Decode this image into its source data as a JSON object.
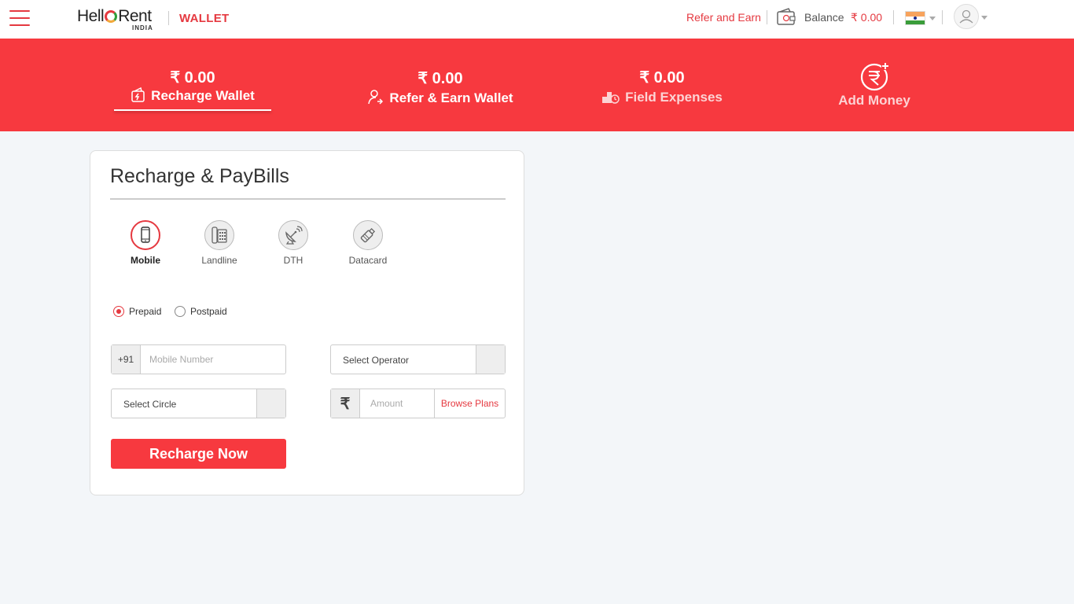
{
  "header": {
    "logo_text": "Hell",
    "logo_text2": "Rent",
    "logo_sub": "INDIA",
    "section": "WALLET",
    "refer_link": "Refer and Earn",
    "balance_label": "Balance",
    "balance_value": "₹ 0.00"
  },
  "banner": {
    "tabs": [
      {
        "amount": "₹ 0.00",
        "label": "Recharge Wallet"
      },
      {
        "amount": "₹ 0.00",
        "label": "Refer & Earn Wallet"
      },
      {
        "amount": "₹ 0.00",
        "label": "Field Expenses"
      },
      {
        "label": "Add Money"
      }
    ]
  },
  "recharge": {
    "title": "Recharge & PayBills",
    "services": [
      {
        "label": "Mobile",
        "icon": "mobile-icon"
      },
      {
        "label": "Landline",
        "icon": "landline-icon"
      },
      {
        "label": "DTH",
        "icon": "dish-antenna-icon"
      },
      {
        "label": "Datacard",
        "icon": "datacard-icon"
      }
    ],
    "plan_types": [
      "Prepaid",
      "Postpaid"
    ],
    "selected_plan": "Prepaid",
    "country_code": "+91",
    "mobile_placeholder": "Mobile Number",
    "operator_placeholder": "Select Operator",
    "circle_placeholder": "Select Circle",
    "currency_symbol": "₹",
    "amount_placeholder": "Amount",
    "browse_plans": "Browse Plans",
    "submit_label": "Recharge Now"
  },
  "colors": {
    "brand_red": "#f7393f",
    "accent_red": "#e53940",
    "page_bg": "#f3f6f9"
  }
}
